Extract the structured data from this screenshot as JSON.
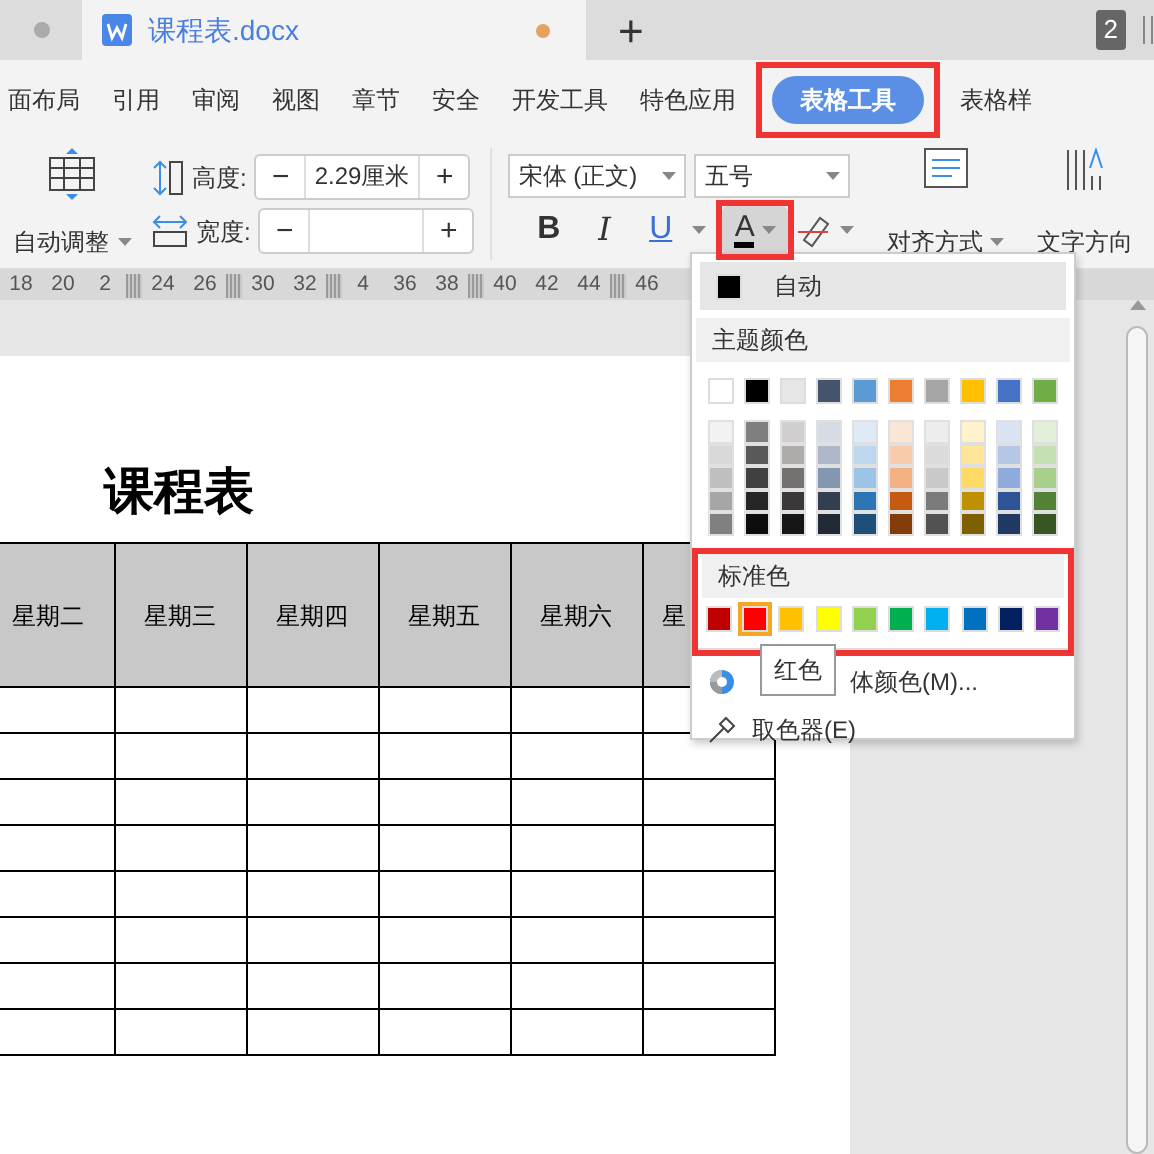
{
  "title_bar": {
    "tab_title": "课程表.docx",
    "modified": true,
    "new_tab": "+",
    "window_count": "2"
  },
  "ribbon_tabs": [
    {
      "label": "面布局",
      "selected": false,
      "highlighted": false
    },
    {
      "label": "引用",
      "selected": false,
      "highlighted": false
    },
    {
      "label": "审阅",
      "selected": false,
      "highlighted": false
    },
    {
      "label": "视图",
      "selected": false,
      "highlighted": false
    },
    {
      "label": "章节",
      "selected": false,
      "highlighted": false
    },
    {
      "label": "安全",
      "selected": false,
      "highlighted": false
    },
    {
      "label": "开发工具",
      "selected": false,
      "highlighted": false
    },
    {
      "label": "特色应用",
      "selected": false,
      "highlighted": false
    },
    {
      "label": "表格工具",
      "selected": true,
      "highlighted": true
    },
    {
      "label": "表格样",
      "selected": false,
      "highlighted": false
    }
  ],
  "toolbar": {
    "auto_fit": "自动调整",
    "height_field": {
      "label": "高度:",
      "minus": "−",
      "value": "2.29厘米",
      "plus": "+"
    },
    "width_field": {
      "label": "宽度:",
      "minus": "−",
      "plus": "+"
    },
    "font_name": "宋体 (正文)",
    "font_size": "五号",
    "format_buttons": [
      {
        "kind": "bold",
        "label": "B"
      },
      {
        "kind": "italic",
        "label": "I"
      },
      {
        "kind": "underline",
        "label": "U"
      }
    ],
    "font_color_button": {
      "label": "A",
      "highlighted": true
    },
    "align": "对齐方式",
    "text_direction": "文字方向"
  },
  "ruler": [
    {
      "kind": "number",
      "label": "18"
    },
    {
      "kind": "number",
      "label": "20"
    },
    {
      "kind": "number",
      "label": "2"
    },
    {
      "kind": "marker"
    },
    {
      "kind": "number",
      "label": "24"
    },
    {
      "kind": "number",
      "label": "26"
    },
    {
      "kind": "marker"
    },
    {
      "kind": "number",
      "label": "30"
    },
    {
      "kind": "number",
      "label": "32"
    },
    {
      "kind": "marker"
    },
    {
      "kind": "number",
      "label": "4"
    },
    {
      "kind": "number",
      "label": "36"
    },
    {
      "kind": "number",
      "label": "38"
    },
    {
      "kind": "marker"
    },
    {
      "kind": "number",
      "label": "40"
    },
    {
      "kind": "number",
      "label": "42"
    },
    {
      "kind": "number",
      "label": "44"
    },
    {
      "kind": "marker"
    },
    {
      "kind": "number",
      "label": "46"
    }
  ],
  "document": {
    "title": "课程表",
    "table": {
      "columns": [
        "星期二",
        "星期三",
        "星期四",
        "星期五",
        "星期六",
        "星"
      ]
    }
  },
  "color_menu": {
    "auto": {
      "label": "自动",
      "color": "#000000"
    },
    "theme_title": "主题颜色",
    "theme_colors": [
      {
        "color": "#ffffff"
      },
      {
        "color": "#000000"
      },
      {
        "color": "#e7e6e6"
      },
      {
        "color": "#44546a"
      },
      {
        "color": "#5b9bd5"
      },
      {
        "color": "#ed7d31"
      },
      {
        "color": "#a5a5a5"
      },
      {
        "color": "#ffc000"
      },
      {
        "color": "#4472c4"
      },
      {
        "color": "#70ad47"
      }
    ],
    "shade_columns": [
      [
        {
          "color": "#f2f2f2"
        },
        {
          "color": "#d9d9d9"
        },
        {
          "color": "#bfbfbf"
        },
        {
          "color": "#a6a6a6"
        },
        {
          "color": "#808080"
        }
      ],
      [
        {
          "color": "#7f7f7f"
        },
        {
          "color": "#595959"
        },
        {
          "color": "#404040"
        },
        {
          "color": "#262626"
        },
        {
          "color": "#0d0d0d"
        }
      ],
      [
        {
          "color": "#d0cece"
        },
        {
          "color": "#aeabab"
        },
        {
          "color": "#757171"
        },
        {
          "color": "#3a3838"
        },
        {
          "color": "#171616"
        }
      ],
      [
        {
          "color": "#d6dce4"
        },
        {
          "color": "#adb9ca"
        },
        {
          "color": "#8497b0"
        },
        {
          "color": "#323f4f"
        },
        {
          "color": "#222a35"
        }
      ],
      [
        {
          "color": "#deebf6"
        },
        {
          "color": "#bdd7ee"
        },
        {
          "color": "#9dc3e6"
        },
        {
          "color": "#2e75b5"
        },
        {
          "color": "#1f4e79"
        }
      ],
      [
        {
          "color": "#fbe5d5"
        },
        {
          "color": "#f8cbad"
        },
        {
          "color": "#f4b183"
        },
        {
          "color": "#c55a11"
        },
        {
          "color": "#843c0b"
        }
      ],
      [
        {
          "color": "#ededed"
        },
        {
          "color": "#dbdbdb"
        },
        {
          "color": "#c9c9c9"
        },
        {
          "color": "#7b7b7b"
        },
        {
          "color": "#525252"
        }
      ],
      [
        {
          "color": "#fff2cc"
        },
        {
          "color": "#fee599"
        },
        {
          "color": "#ffd965"
        },
        {
          "color": "#bf9000"
        },
        {
          "color": "#7f6000"
        }
      ],
      [
        {
          "color": "#dae3f3"
        },
        {
          "color": "#b4c7e7"
        },
        {
          "color": "#8faadc"
        },
        {
          "color": "#2f5496"
        },
        {
          "color": "#1f3864"
        }
      ],
      [
        {
          "color": "#e2efd9"
        },
        {
          "color": "#c5e0b3"
        },
        {
          "color": "#a8d08d"
        },
        {
          "color": "#538135"
        },
        {
          "color": "#375623"
        }
      ]
    ],
    "standard_title": "标准色",
    "standard_highlighted": true,
    "standard_colors": [
      {
        "color": "#c00000",
        "selected": false
      },
      {
        "color": "#ff0000",
        "selected": true
      },
      {
        "color": "#ffc000",
        "selected": false
      },
      {
        "color": "#ffff00",
        "selected": false
      },
      {
        "color": "#92d050",
        "selected": false
      },
      {
        "color": "#00b050",
        "selected": false
      },
      {
        "color": "#00b0f0",
        "selected": false
      },
      {
        "color": "#0070c0",
        "selected": false
      },
      {
        "color": "#002060",
        "selected": false
      },
      {
        "color": "#7030a0",
        "selected": false
      }
    ],
    "tooltip": "红色",
    "more_colors": "体颜色(M)...",
    "eyedropper": "取色器(E)"
  }
}
